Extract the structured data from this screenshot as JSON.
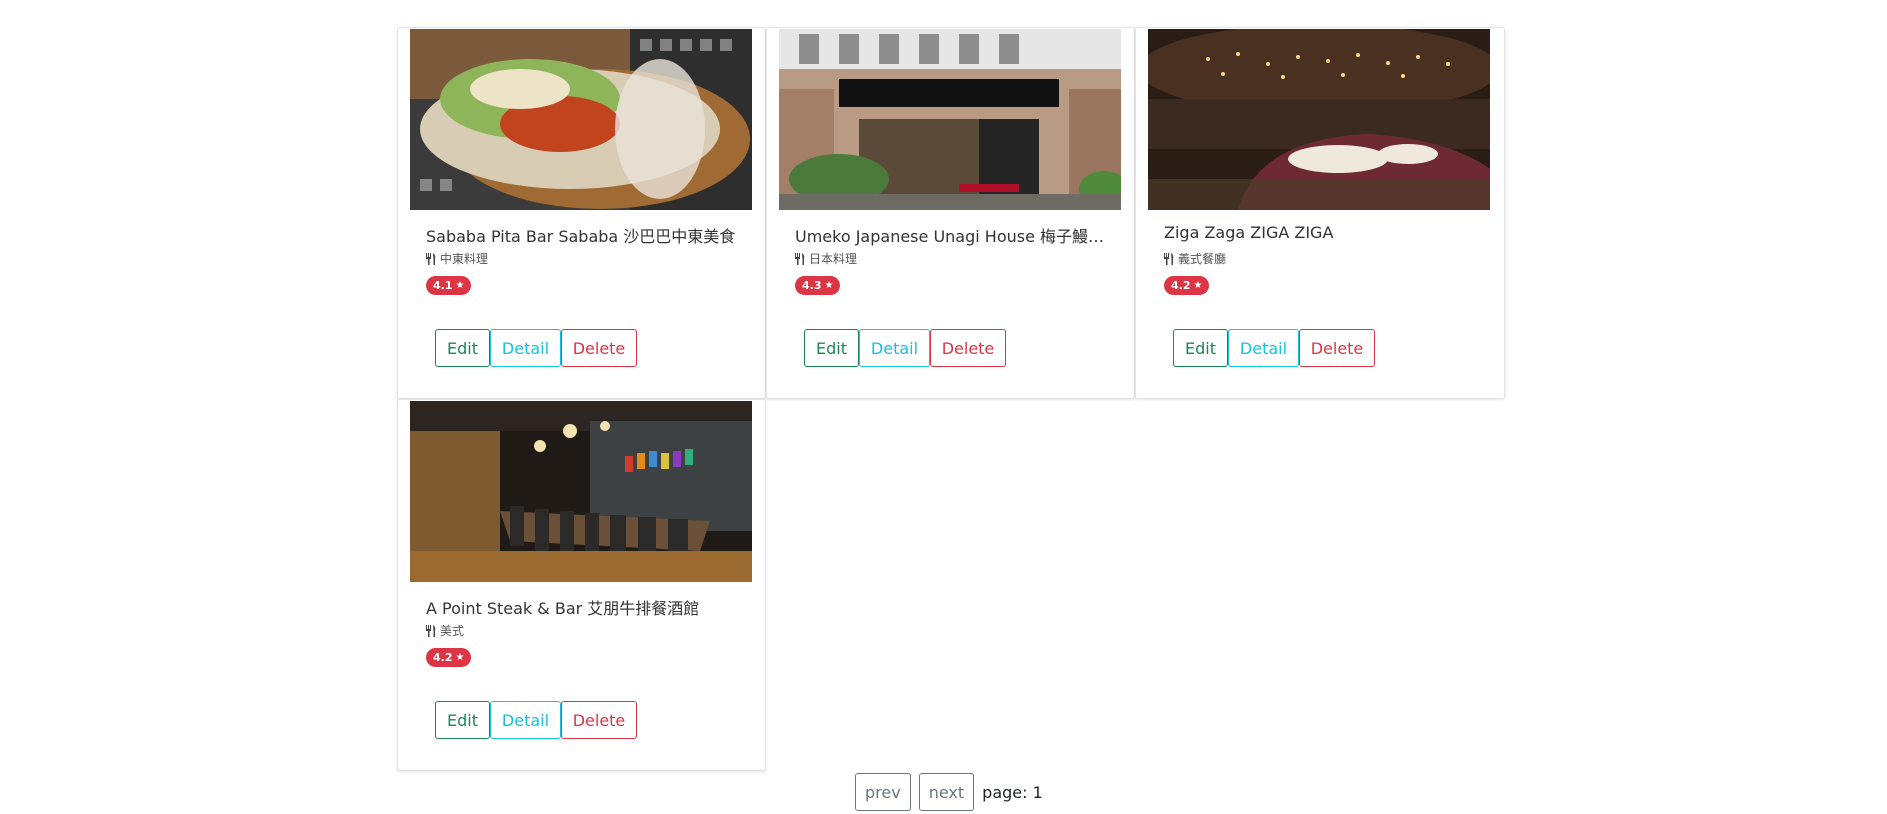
{
  "restaurants": [
    {
      "name": "Sababa Pita Bar Sababa 沙巴巴中東美食",
      "category": "中東料理",
      "rating": "4.1",
      "image": "pita-sandwich-photo"
    },
    {
      "name": "Umeko Japanese Unagi House 梅子鰻蒲...",
      "category": "日本料理",
      "rating": "4.3",
      "image": "restaurant-storefront-photo"
    },
    {
      "name": "Ziga Zaga ZIGA ZIGA",
      "category": "義式餐廳",
      "rating": "4.2",
      "image": "dining-room-photo"
    },
    {
      "name": "A Point Steak & Bar 艾朋牛排餐酒館",
      "category": "美式",
      "rating": "4.2",
      "image": "private-dining-room-photo"
    }
  ],
  "actions": {
    "edit_label": "Edit",
    "detail_label": "Detail",
    "delete_label": "Delete"
  },
  "pagination": {
    "prev_label": "prev",
    "next_label": "next",
    "page_label": "page: 1"
  },
  "icons": {
    "category": "utensils-icon",
    "rating": "star-icon"
  },
  "colors": {
    "rating_badge": "#dc3545",
    "edit": "#198754",
    "detail": "#17c1e0",
    "delete": "#dc3545"
  }
}
